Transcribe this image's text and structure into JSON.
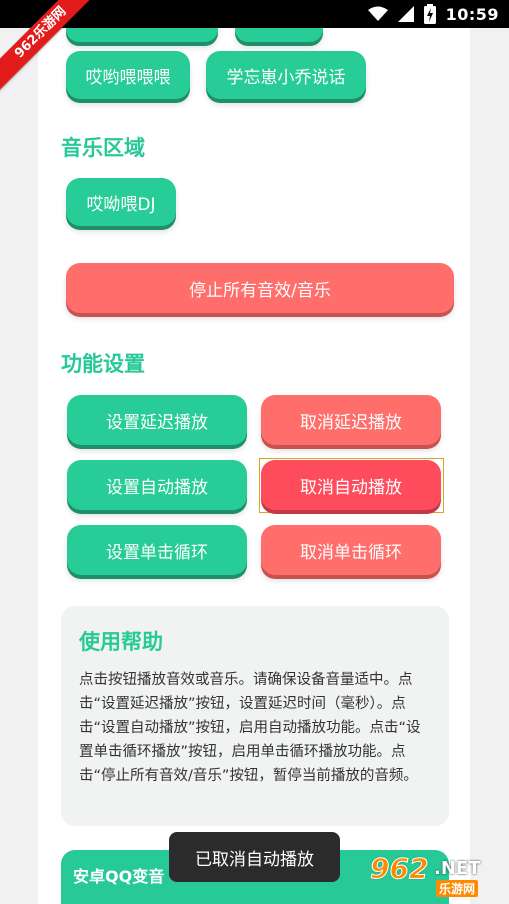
{
  "status_bar": {
    "time": "10:59"
  },
  "ribbon": {
    "label": "962乐游网"
  },
  "top_buttons": [
    {
      "label": "哎哟喂喂喂"
    },
    {
      "label": "学忘崽小乔说话"
    }
  ],
  "music_section": {
    "title": "音乐区域",
    "buttons": [
      {
        "label": "哎呦喂DJ"
      }
    ]
  },
  "stop_all_label": "停止所有音效/音乐",
  "function_section": {
    "title": "功能设置",
    "set_delay": "设置延迟播放",
    "cancel_delay": "取消延迟播放",
    "set_auto": "设置自动播放",
    "cancel_auto": "取消自动播放",
    "set_loop": "设置单击循环",
    "cancel_loop": "取消单击循环"
  },
  "help": {
    "title": "使用帮助",
    "text": "点击按钮播放音效或音乐。请确保设备音量适中。点击“设置延迟播放”按钮，设置延迟时间（毫秒）。点击“设置自动播放”按钮，启用自动播放功能。点击“设置单击循环播放”按钮，启用单击循环播放功能。点击“停止所有音效/音乐”按钮，暂停当前播放的音频。"
  },
  "bottom_bar": {
    "title": "安卓QQ变音"
  },
  "toast": {
    "text": "已取消自动播放"
  },
  "watermark": {
    "number": "962",
    "suffix": ".NET",
    "sub": "乐游网"
  },
  "colors": {
    "green": "#27cc97",
    "red": "#ff6e6b",
    "red_active": "#ff4c5c",
    "section_title": "#27c997"
  },
  "icons": [
    "wifi-icon",
    "signal-icon",
    "battery-charging-icon"
  ]
}
